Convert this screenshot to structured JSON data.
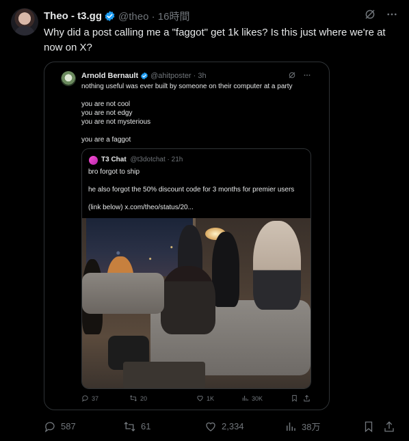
{
  "post": {
    "author_name": "Theo - t3.gg",
    "handle": "@theo",
    "time": "16時間",
    "text": "Why did a post calling me a \"faggot\" get 1k likes? Is this just where we're at now on X?",
    "stats": {
      "replies": "587",
      "reposts": "61",
      "likes": "2,334",
      "views": "38万"
    }
  },
  "quoted": {
    "author_name": "Arnold Bernault",
    "handle": "@ahitposter",
    "time": "3h",
    "lines": [
      "nothing useful was ever built by someone on their computer at a party",
      "",
      "you are not cool",
      "you are not edgy",
      "you are not mysterious",
      "",
      "you are a faggot"
    ],
    "stats": {
      "replies": "37",
      "reposts": "20",
      "likes": "1K",
      "views": "30K"
    }
  },
  "inner_quote": {
    "author_name": "T3 Chat",
    "handle": "@t3dotchat",
    "time": "21h",
    "line1": "bro forgot to ship",
    "line2": "he also forgot the 50% discount code for 3 months for premier users",
    "line3": "(link below)  x.com/theo/status/20..."
  },
  "colors": {
    "background": "#000000",
    "text": "#e7e9ea",
    "muted": "#71767b",
    "verified": "#1d9bf0",
    "border": "#2f3336"
  },
  "icons": [
    "grok-icon",
    "more-icon",
    "verified-icon",
    "reply-icon",
    "repost-icon",
    "like-icon",
    "views-icon",
    "bookmark-icon",
    "share-icon"
  ]
}
